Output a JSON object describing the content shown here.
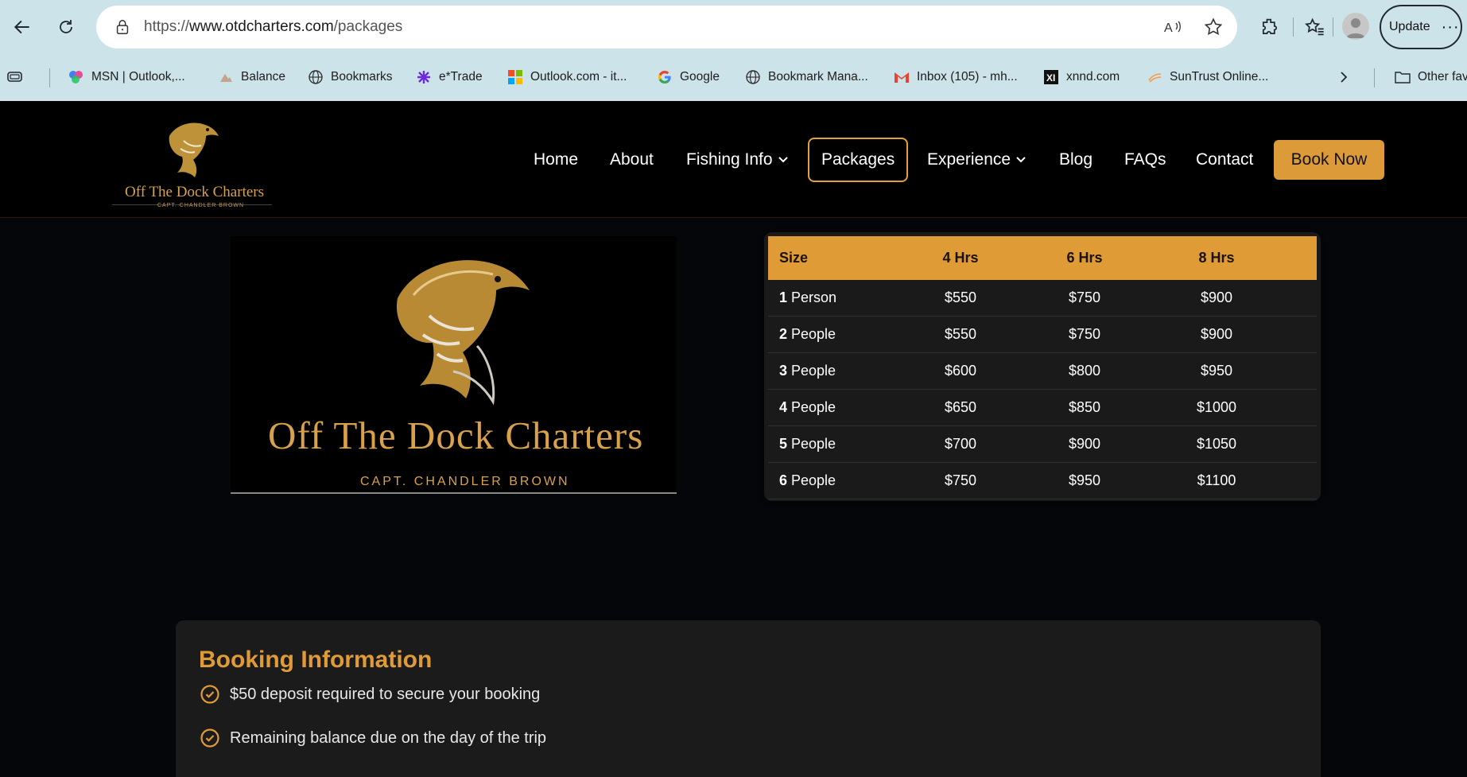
{
  "browser": {
    "url_prefix": "https://",
    "url_domain": "www.otdcharters.com",
    "url_path": "/packages",
    "update_label": "Update",
    "more_label": "···",
    "bookmarks": [
      {
        "label": "MSN | Outlook,...",
        "icon": "msn-icon"
      },
      {
        "label": "Balance",
        "icon": "balance-icon"
      },
      {
        "label": "Bookmarks",
        "icon": "globe-icon"
      },
      {
        "label": "e*Trade",
        "icon": "etrade-icon"
      },
      {
        "label": "Outlook.com - it...",
        "icon": "microsoft-icon"
      },
      {
        "label": "Google",
        "icon": "google-icon"
      },
      {
        "label": "Bookmark Mana...",
        "icon": "globe-icon"
      },
      {
        "label": "Inbox (105) - mh...",
        "icon": "gmail-icon"
      },
      {
        "label": "xnnd.com",
        "icon": "xnnd-icon"
      },
      {
        "label": "SunTrust Online...",
        "icon": "suntrust-icon"
      }
    ],
    "other_favorites": "Other fav"
  },
  "site": {
    "logo_title": "Off The Dock Charters",
    "logo_sub": "CAPT. CHANDLER BROWN",
    "nav": {
      "home": "Home",
      "about": "About",
      "fishing_info": "Fishing Info",
      "packages": "Packages",
      "experience": "Experience",
      "blog": "Blog",
      "faqs": "FAQs",
      "contact": "Contact",
      "book_now": "Book Now"
    },
    "accent_color": "#dc9b38"
  },
  "hero": {
    "title": "Off  The Dock Charters",
    "subtitle": "CAPT. CHANDLER BROWN"
  },
  "pricing": {
    "headers": [
      "Size",
      "4 Hrs",
      "6 Hrs",
      "8 Hrs"
    ],
    "rows": [
      {
        "num": "1",
        "unit": " Person",
        "p4": "$550",
        "p6": "$750",
        "p8": "$900"
      },
      {
        "num": "2",
        "unit": " People",
        "p4": "$550",
        "p6": "$750",
        "p8": "$900"
      },
      {
        "num": "3",
        "unit": " People",
        "p4": "$600",
        "p6": "$800",
        "p8": "$950"
      },
      {
        "num": "4",
        "unit": " People",
        "p4": "$650",
        "p6": "$850",
        "p8": "$1000"
      },
      {
        "num": "5",
        "unit": " People",
        "p4": "$700",
        "p6": "$900",
        "p8": "$1050"
      },
      {
        "num": "6",
        "unit": " People",
        "p4": "$750",
        "p6": "$950",
        "p8": "$1100"
      }
    ]
  },
  "booking": {
    "title": "Booking Information",
    "items": [
      "$50 deposit required to secure your booking",
      "Remaining balance due on the day of the trip"
    ]
  }
}
